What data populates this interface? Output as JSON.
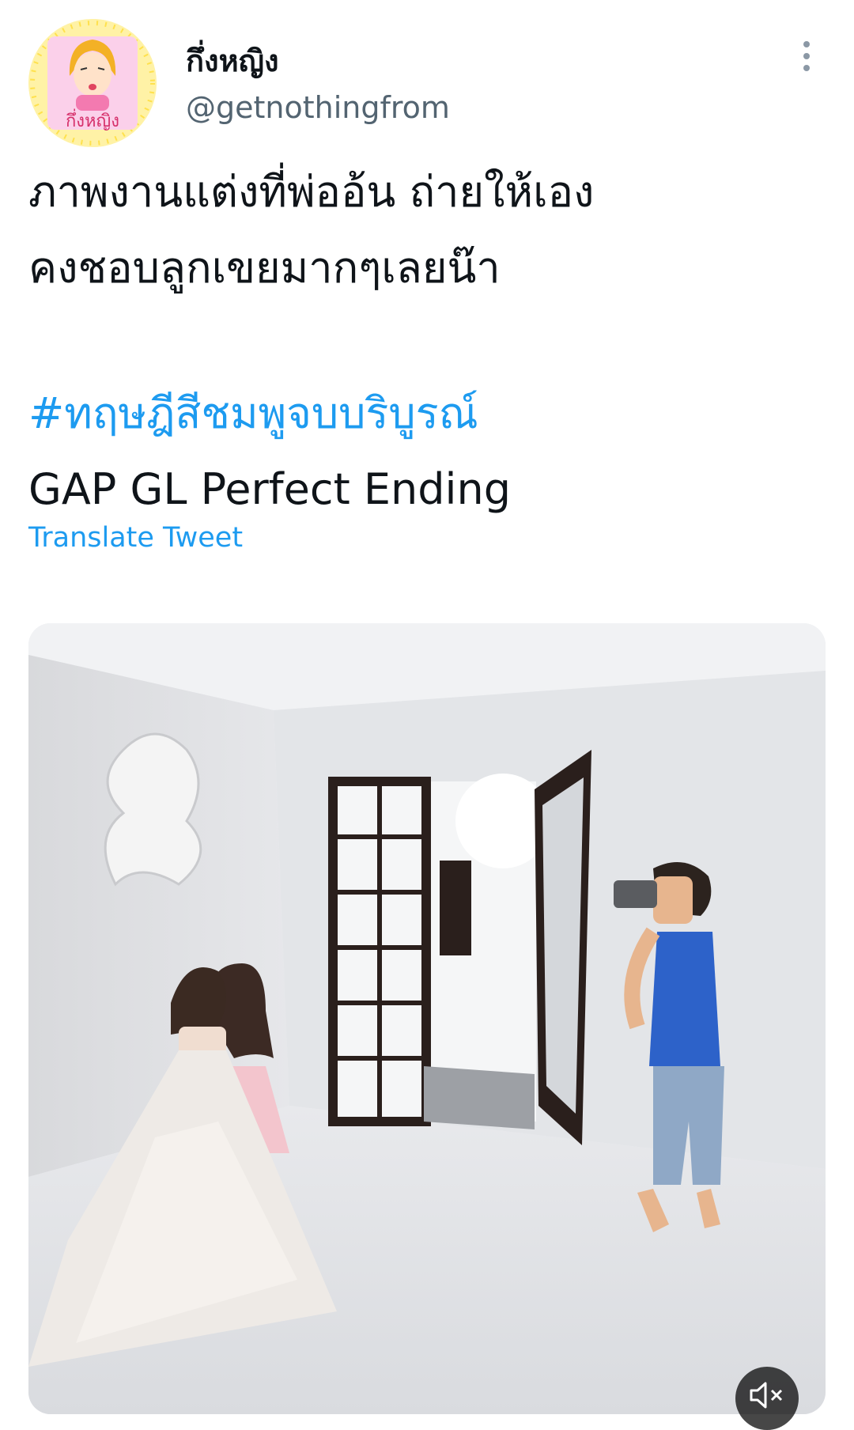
{
  "tweet": {
    "display_name": "กึ่งหญิง",
    "handle": "@getnothingfrom",
    "avatar_label": "กึ่งหญิง",
    "text_lines": [
      "ภาพงานแต่งที่พ่ออ้น ถ่ายให้เอง",
      "คงชอบลูกเขยมากๆเลยน๊า"
    ],
    "hashtag": "#ทฤษฎีสีชมพูจบบริบูรณ์",
    "subtitle": "GAP GL Perfect Ending",
    "translate_label": "Translate Tweet"
  },
  "media": {
    "type": "video",
    "muted": true
  },
  "icons": {
    "more": "more-vertical-icon",
    "mute": "volume-muted-icon"
  },
  "colors": {
    "text": "#0f1419",
    "secondary": "#536471",
    "link": "#1d9bf0"
  }
}
